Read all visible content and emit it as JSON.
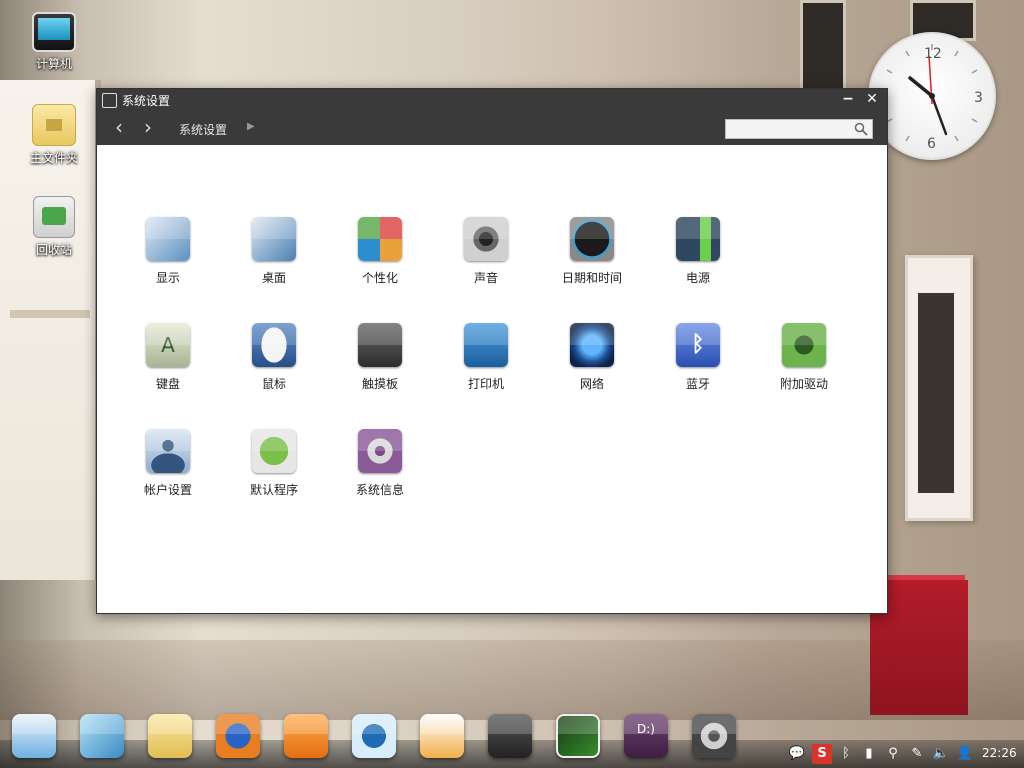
{
  "desktop": {
    "icons": [
      {
        "label": "计算机",
        "icon": "computer-icon"
      },
      {
        "label": "主文件夹",
        "icon": "home-folder-icon"
      },
      {
        "label": "回收站",
        "icon": "trash-icon"
      }
    ]
  },
  "clock": {
    "n12": "12",
    "n3": "3",
    "n6": "6"
  },
  "window": {
    "title": "系统设置",
    "breadcrumb": "系统设置",
    "search_placeholder": ""
  },
  "settings": {
    "row1": [
      {
        "label": "显示",
        "color": "#5c8fbf"
      },
      {
        "label": "桌面",
        "color": "#4b7fb0"
      },
      {
        "label": "个性化",
        "color": "#c24848"
      },
      {
        "label": "声音",
        "color": "#9a9a9a"
      },
      {
        "label": "日期和时间",
        "color": "#1d1d1d"
      },
      {
        "label": "电源",
        "color": "#3e5e82"
      }
    ],
    "row2": [
      {
        "label": "键盘",
        "color": "#b9c3a8"
      },
      {
        "label": "鼠标",
        "color": "#3a6aa7"
      },
      {
        "label": "触摸板",
        "color": "#4a4a4a"
      },
      {
        "label": "打印机",
        "color": "#2e74b4"
      },
      {
        "label": "网络",
        "color": "#1f4f8a"
      },
      {
        "label": "蓝牙",
        "color": "#3c66c4"
      },
      {
        "label": "附加驱动",
        "color": "#4d8f3c"
      }
    ],
    "row3": [
      {
        "label": "帐户设置",
        "color": "#6f8fb3"
      },
      {
        "label": "默认程序",
        "color": "#7db04a"
      },
      {
        "label": "系统信息",
        "color": "#7a4a86"
      }
    ]
  },
  "tray": {
    "time": "22:26"
  }
}
